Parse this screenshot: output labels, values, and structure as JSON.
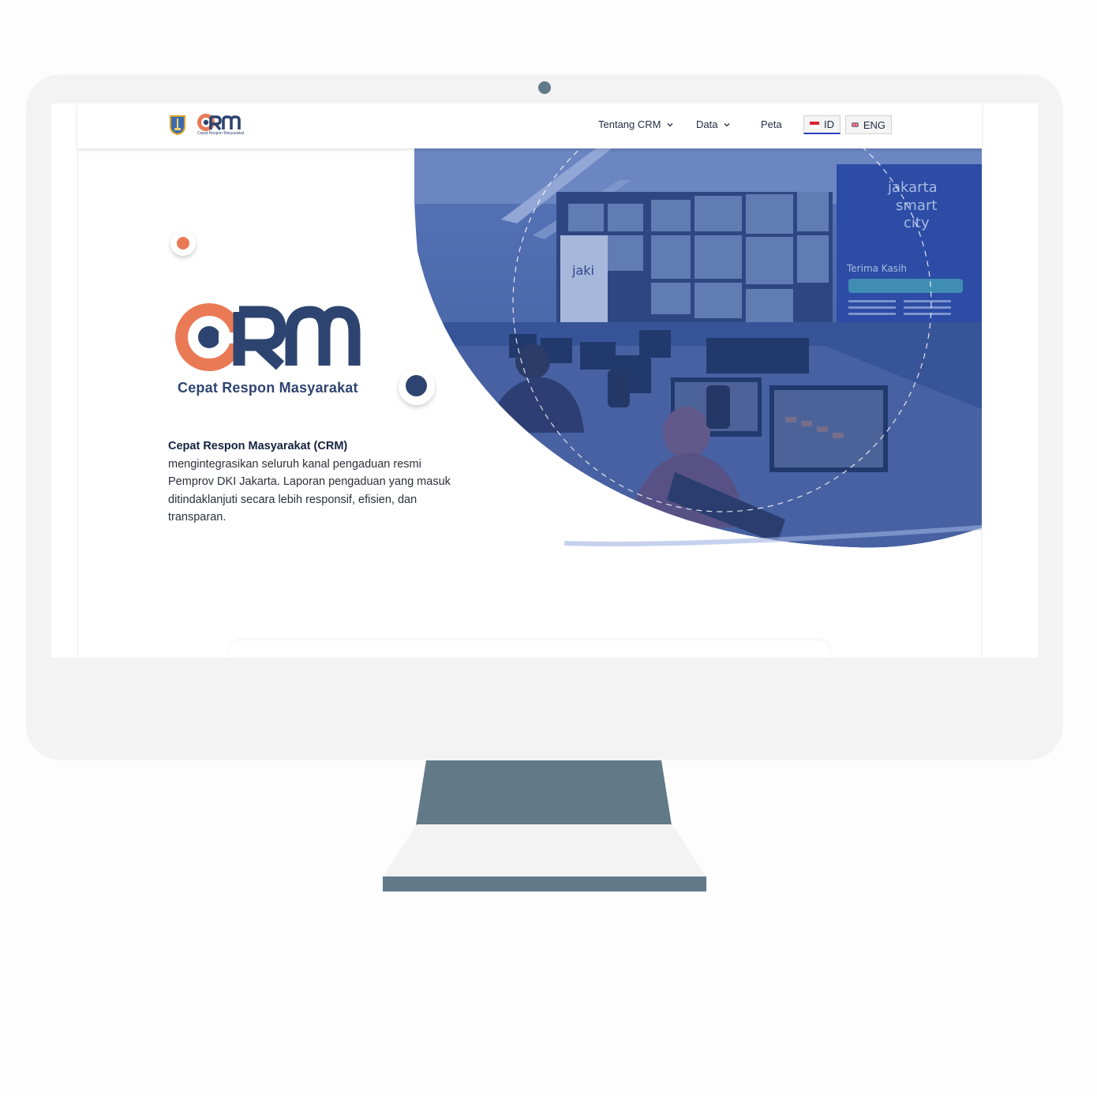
{
  "nav": {
    "logo_alt": "CRM",
    "logo_subtitle": "Cepat Respon Masyarakat",
    "items": [
      {
        "label": "Tentang CRM",
        "has_dropdown": true
      },
      {
        "label": "Data",
        "has_dropdown": true
      },
      {
        "label": "Peta",
        "has_dropdown": false
      }
    ],
    "languages": [
      {
        "code": "ID",
        "active": true
      },
      {
        "code": "ENG",
        "active": false
      }
    ]
  },
  "hero": {
    "logo_text": "CRM",
    "logo_subtitle": "Cepat Respon Masyarakat",
    "description_bold": "Cepat Respon Masyarakat (CRM)",
    "description_rest": "mengintegrasikan seluruh kanal pengaduan resmi Pemprov DKI Jakarta. Laporan pengaduan yang masuk ditindaklanjuti secara lebih responsif, efisien, dan transparan.",
    "image_texts": {
      "screen_brand": "jakarta smart city",
      "screen_heading": "Terima Kasih",
      "app_name": "jaki"
    }
  },
  "colors": {
    "brand_orange": "#e97a55",
    "brand_navy": "#2e4470",
    "overlay_blue": "#2e55a8",
    "monitor_frame": "#f3f3f3",
    "monitor_stand": "#627a88"
  }
}
